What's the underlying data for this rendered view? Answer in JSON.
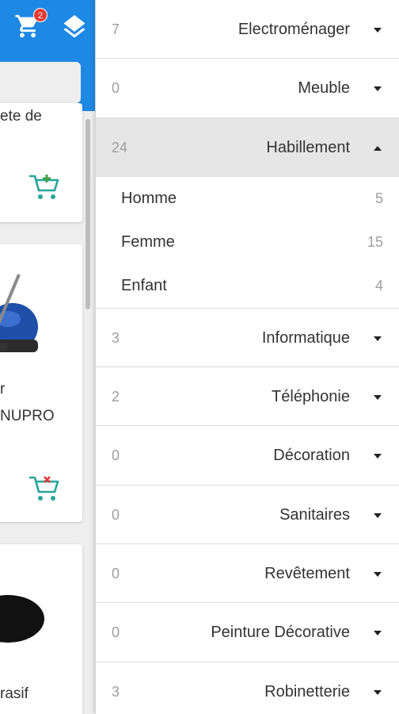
{
  "header": {
    "cart_badge": "2",
    "cart_icon": "cart-icon",
    "layers_icon": "layers-icon",
    "accent": "#1e88e5"
  },
  "left_cards": {
    "card1_text": "ete de",
    "card2_text_a": "r",
    "card2_text_b": "NUPRO",
    "card3_text": "rasif"
  },
  "categories": [
    {
      "count": "7",
      "name": "Electroménager",
      "open": false
    },
    {
      "count": "0",
      "name": "Meuble",
      "open": false
    },
    {
      "count": "24",
      "name": "Habillement",
      "open": true,
      "subs": [
        {
          "name": "Homme",
          "count": "5"
        },
        {
          "name": "Femme",
          "count": "15"
        },
        {
          "name": "Enfant",
          "count": "4"
        }
      ]
    },
    {
      "count": "3",
      "name": "Informatique",
      "open": false
    },
    {
      "count": "2",
      "name": "Téléphonie",
      "open": false
    },
    {
      "count": "0",
      "name": "Décoration",
      "open": false
    },
    {
      "count": "0",
      "name": "Sanitaires",
      "open": false
    },
    {
      "count": "0",
      "name": "Revêtement",
      "open": false
    },
    {
      "count": "0",
      "name": "Peinture Décorative",
      "open": false
    },
    {
      "count": "3",
      "name": "Robinetterie",
      "open": false
    }
  ]
}
